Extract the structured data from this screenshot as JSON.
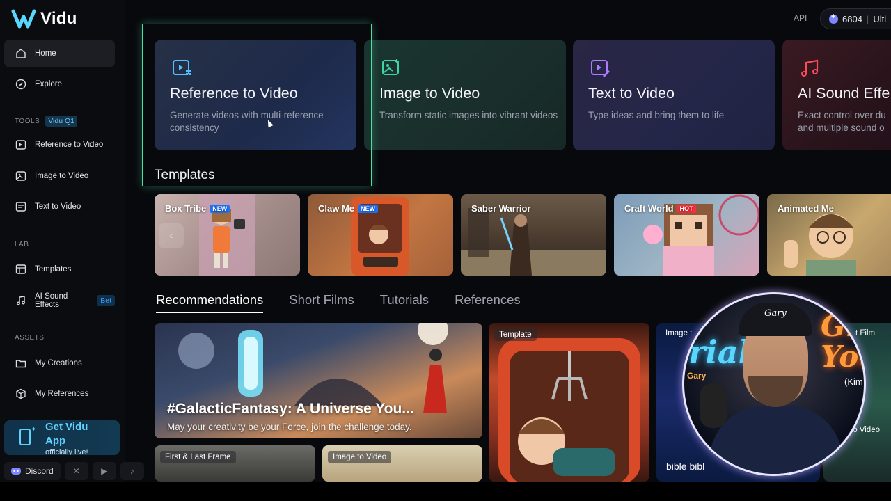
{
  "brand": {
    "name": "Vidu"
  },
  "sidebar": {
    "nav": [
      {
        "label": "Home",
        "icon": "home-icon"
      },
      {
        "label": "Explore",
        "icon": "compass-icon"
      }
    ],
    "tools_label": "TOOLS",
    "tools_badge": "Vidu Q1",
    "tools": [
      {
        "label": "Reference to Video",
        "icon": "reference-video-icon"
      },
      {
        "label": "Image to Video",
        "icon": "image-video-icon"
      },
      {
        "label": "Text to Video",
        "icon": "text-video-icon"
      }
    ],
    "lab_label": "LAB",
    "lab": [
      {
        "label": "Templates",
        "icon": "templates-icon"
      },
      {
        "label": "AI Sound Effects",
        "icon": "music-note-icon",
        "badge": "Bet"
      }
    ],
    "assets_label": "ASSETS",
    "assets": [
      {
        "label": "My Creations",
        "icon": "folder-icon"
      },
      {
        "label": "My References",
        "icon": "cube-icon"
      }
    ],
    "app_promo": {
      "title": "Get Vidu App",
      "subtitle": "officially live!"
    },
    "discord_label": "Discord"
  },
  "topbar": {
    "api_label": "API",
    "credits": "6804",
    "plan": "Ulti"
  },
  "tool_cards": [
    {
      "title": "Reference to Video",
      "desc": "Generate videos with multi-reference consistency"
    },
    {
      "title": "Image to Video",
      "desc": "Transform static images into vibrant videos"
    },
    {
      "title": "Text to Video",
      "desc": "Type ideas and bring them to life"
    },
    {
      "title": "AI Sound Effe",
      "desc": "Exact control over du and multiple sound o"
    }
  ],
  "templates": {
    "title": "Templates",
    "items": [
      {
        "label": "Box Tribe",
        "badge": "NEW"
      },
      {
        "label": "Claw Me",
        "badge": "NEW"
      },
      {
        "label": "Saber Warrior",
        "badge": ""
      },
      {
        "label": "Craft World",
        "badge": "HOT"
      },
      {
        "label": "Animated Me",
        "badge": ""
      }
    ]
  },
  "tabs": [
    "Recommendations",
    "Short Films",
    "Tutorials",
    "References"
  ],
  "feed": {
    "feature_title": "#GalacticFantasy: A Universe You...",
    "feature_sub": "May your creativity be your Force, join the challenge today.",
    "chips": {
      "first_last": "First & Last Frame",
      "image_to_video": "Image to Video",
      "template": "Template",
      "image": "Image t",
      "film": "t Film",
      "video": "to Video"
    },
    "caption": "bible bibl"
  },
  "webcam": {
    "cap_text": "Gary",
    "sign_left": "rial",
    "sign_right": "Gr You",
    "tag": "Gary",
    "right_text": "(Kim"
  },
  "colors": {
    "accent": "#4ce0a0",
    "brand_blue": "#5fd3ff",
    "new_badge": "#1b74ff",
    "hot_badge": "#ff2d3d"
  }
}
